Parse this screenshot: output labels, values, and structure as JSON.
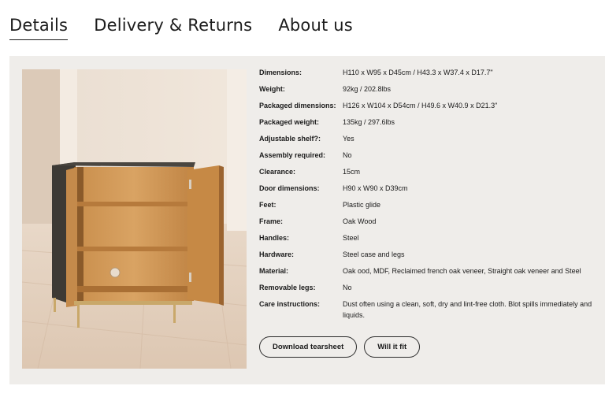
{
  "tabs": [
    {
      "label": "Details"
    },
    {
      "label": "Delivery & Returns"
    },
    {
      "label": "About us"
    }
  ],
  "specs": [
    {
      "label": "Dimensions:",
      "value": "H110 x W95 x D45cm / H43.3 x W37.4 x D17.7\""
    },
    {
      "label": "Weight:",
      "value": "92kg / 202.8lbs"
    },
    {
      "label": "Packaged dimensions:",
      "value": "H126 x W104 x D54cm / H49.6 x W40.9 x D21.3\""
    },
    {
      "label": "Packaged weight:",
      "value": "135kg / 297.6lbs"
    },
    {
      "label": "Adjustable shelf?:",
      "value": "Yes"
    },
    {
      "label": "Assembly required:",
      "value": "No"
    },
    {
      "label": "Clearance:",
      "value": "15cm"
    },
    {
      "label": "Door dimensions:",
      "value": "H90 x W90 x D39cm"
    },
    {
      "label": "Feet:",
      "value": "Plastic glide"
    },
    {
      "label": "Frame:",
      "value": "Oak Wood"
    },
    {
      "label": "Handles:",
      "value": "Steel"
    },
    {
      "label": "Hardware:",
      "value": "Steel case and legs"
    },
    {
      "label": "Material:",
      "value": "Oak ood, MDF, Reclaimed french oak veneer, Straight oak veneer and Steel"
    },
    {
      "label": "Removable legs:",
      "value": "No"
    },
    {
      "label": "Care instructions:",
      "value": "Dust often using a clean, soft, dry and lint-free cloth. Blot spills immediately and liquids."
    }
  ],
  "buttons": {
    "tearsheet": "Download tearsheet",
    "fit": "Will it fit"
  }
}
